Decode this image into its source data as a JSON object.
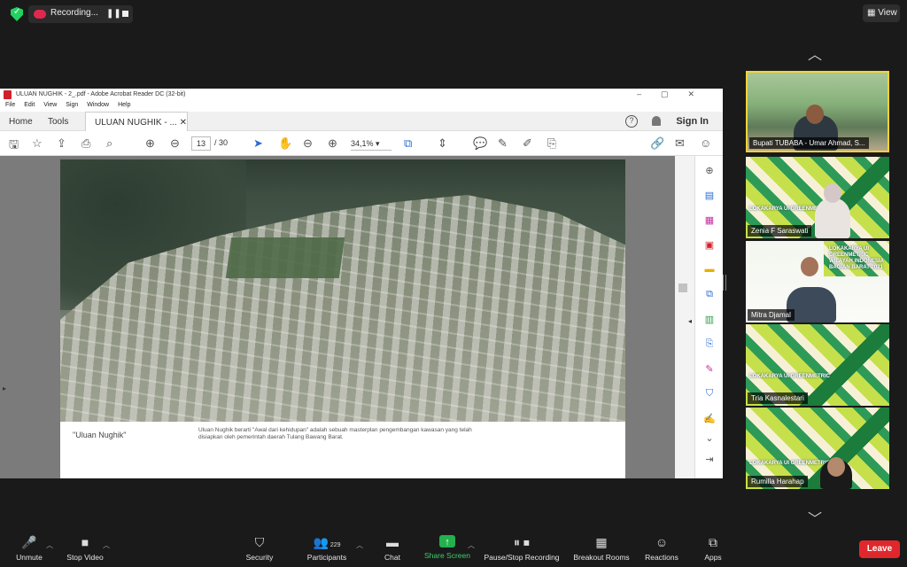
{
  "topbar": {
    "recording_label": "Recording...",
    "view_label": "View"
  },
  "acrobat": {
    "window_title": "ULUAN NUGHIK - 2_.pdf - Adobe Acrobat Reader DC (32-bit)",
    "menu": [
      "File",
      "Edit",
      "View",
      "Sign",
      "Window",
      "Help"
    ],
    "tabs": {
      "home": "Home",
      "tools": "Tools",
      "doc": "ULUAN NUGHIK - ..."
    },
    "sign_in": "Sign In",
    "page_current": "13",
    "page_total": "/ 30",
    "zoom": "34,1%",
    "caption_title": "\"Uluan Nughik\"",
    "caption_desc": "Uluan Nughik berarti \"Awal dari kehidupan\" adalah sebuah masterplan pengembangan kawasan yang telah disiapkan oleh pemerintah daerah Tulang Bawang Barat."
  },
  "participants": [
    {
      "name": "Bupati TUBABA - Umar Ahmad, S...",
      "bg": "photo",
      "active": true
    },
    {
      "name": "Zenia F Saraswati",
      "bg": "green",
      "banner": "LOKAKARYA UI GREENMETRIC"
    },
    {
      "name": "Mitra Djamal",
      "bg": "white",
      "banner": "LOKAKARYA UI GREENMETRIC WILAYAH INDONESIA BAGIAN BARAT 2021"
    },
    {
      "name": "Tria Kasnalestari",
      "bg": "green",
      "banner": "LOKAKARYA UI GREENMETRIC"
    },
    {
      "name": "Rumilla Harahap",
      "bg": "green",
      "banner": "LOKAKARYA UI GREENMETRIC"
    }
  ],
  "bottombar": {
    "unmute": "Unmute",
    "stop_video": "Stop Video",
    "security": "Security",
    "participants": "Participants",
    "participants_count": "229",
    "chat": "Chat",
    "share_screen": "Share Screen",
    "pause_stop_recording": "Pause/Stop Recording",
    "breakout_rooms": "Breakout Rooms",
    "reactions": "Reactions",
    "apps": "Apps",
    "leave": "Leave"
  },
  "colors": {
    "leave": "#e0282c",
    "share": "#23b14d",
    "active_speaker": "#f2d33a",
    "recording": "#e0284f"
  }
}
